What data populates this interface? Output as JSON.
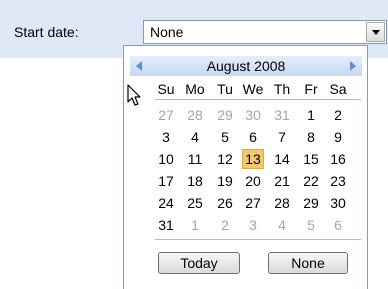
{
  "form": {
    "start_label": "Start date:",
    "select_value": "None"
  },
  "calendar": {
    "month_title": "August 2008",
    "weekdays": [
      "Su",
      "Mo",
      "Tu",
      "We",
      "Th",
      "Fr",
      "Sa"
    ],
    "weeks": [
      [
        "27",
        "28",
        "29",
        "30",
        "31",
        "1",
        "2"
      ],
      [
        "3",
        "4",
        "5",
        "6",
        "7",
        "8",
        "9"
      ],
      [
        "10",
        "11",
        "12",
        "13",
        "14",
        "15",
        "16"
      ],
      [
        "17",
        "18",
        "19",
        "20",
        "21",
        "22",
        "23"
      ],
      [
        "24",
        "25",
        "26",
        "27",
        "28",
        "29",
        "30"
      ],
      [
        "31",
        "1",
        "2",
        "3",
        "4",
        "5",
        "6"
      ]
    ],
    "selected_day": "13",
    "today_label": "Today",
    "none_label": "None"
  },
  "colors": {
    "header_band": "#dfe8f6",
    "selected_day_bg": "#f5c76e",
    "other_month_text": "#a5a5a5",
    "nav_arrow": "#5c8fd4"
  },
  "icons": {
    "dropdown": "chevron-down-icon",
    "prev": "chevron-left-icon",
    "next": "chevron-right-icon",
    "cursor": "mouse-pointer-icon"
  }
}
